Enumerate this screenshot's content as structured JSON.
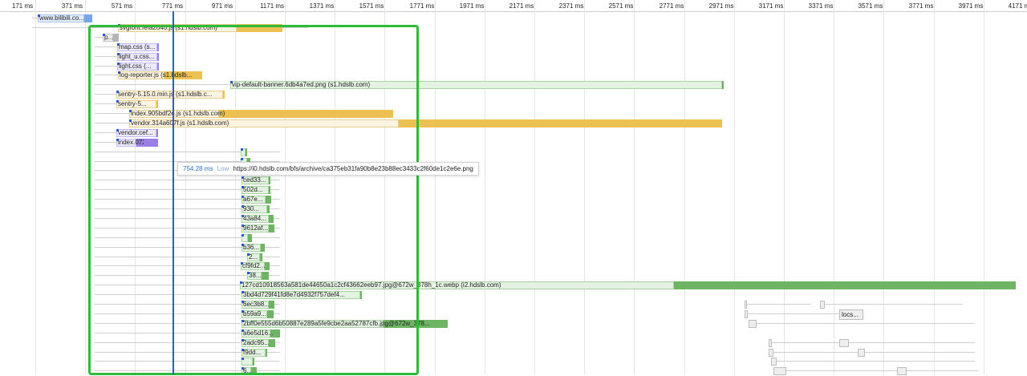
{
  "ruler": {
    "ticks": [
      "171 ms",
      "371 ms",
      "571 ms",
      "771 ms",
      "971 ms",
      "1171 ms",
      "1371 ms",
      "1571 ms",
      "1771 ms",
      "1971 ms",
      "2171 ms",
      "2371 ms",
      "2571 ms",
      "2771 ms",
      "2971 ms",
      "3171 ms",
      "3371 ms",
      "3571 ms",
      "3771 ms",
      "3971 ms",
      "4171 ms"
    ]
  },
  "requests": [
    {
      "label": "www.bilibili.co...",
      "kind": "doc"
    },
    {
      "label": "svgfont.fefa2646.js (s1.hdslb.com)",
      "kind": "script"
    },
    {
      "label": "p...",
      "kind": "other"
    },
    {
      "label": "map.css (s...",
      "kind": "css"
    },
    {
      "label": "light_u.css...",
      "kind": "css"
    },
    {
      "label": "light.css (...",
      "kind": "css"
    },
    {
      "label": "log-reporter.js (s1.hdslb...",
      "kind": "script"
    },
    {
      "label": "vip-default-banner.6db4a7ed.png (s1.hdslb.com)",
      "kind": "image"
    },
    {
      "label": "sentry-5.15.0.min.js (s1.hdslb.c...",
      "kind": "script"
    },
    {
      "label": "sentry-5...",
      "kind": "script"
    },
    {
      "label": "index.905bdf2e.js (s1.hdslb.com)",
      "kind": "script"
    },
    {
      "label": "vendor.314a607f.js (s1.hdslb.com)",
      "kind": "script"
    },
    {
      "label": "vendor.cef...",
      "kind": "css"
    },
    {
      "label": "index.072...",
      "kind": "css"
    },
    {
      "label": "",
      "kind": "image"
    },
    {
      "label": "",
      "kind": "image"
    },
    {
      "label": "",
      "kind": "image"
    },
    {
      "label": "ced33...",
      "kind": "image"
    },
    {
      "label": "502d...",
      "kind": "image"
    },
    {
      "label": "a67e...",
      "kind": "image"
    },
    {
      "label": "930...",
      "kind": "image"
    },
    {
      "label": "43a84...",
      "kind": "image"
    },
    {
      "label": "9612af...",
      "kind": "image"
    },
    {
      "label": "",
      "kind": "image"
    },
    {
      "label": "b36...",
      "kind": "image"
    },
    {
      "label": "2...",
      "kind": "image"
    },
    {
      "label": "cf9fd2...",
      "kind": "image"
    },
    {
      "label": "38...",
      "kind": "image"
    },
    {
      "label": "127cd10918563a581de44650a1c2cf43662eeb97.jpg@672w_378h_1c.webp (i2.hdslb.com)",
      "kind": "image"
    },
    {
      "label": "3bd4d729f41fd8e7d4932f757def4...",
      "kind": "image"
    },
    {
      "label": "6ec3b8...",
      "kind": "image"
    },
    {
      "label": "b59a9...",
      "kind": "image"
    },
    {
      "label": "2bff0e555d6b50887e289a5fe9cbe2aa52787cfb.jpg@672w_378...",
      "kind": "image"
    },
    {
      "label": "a6e5d16...",
      "kind": "image"
    },
    {
      "label": "2adc95...",
      "kind": "image"
    },
    {
      "label": "f9dd...",
      "kind": "image"
    },
    {
      "label": "",
      "kind": "image"
    },
    {
      "label": "6...",
      "kind": "image"
    }
  ],
  "side_requests": [
    {
      "label": "locs..."
    }
  ],
  "tooltip": {
    "time": "754.28 ms",
    "priority": "Low",
    "url": "https://i0.hdslb.com/bfs/archive/ca375eb31fa90b8e23b88ec3433c2f60de1c2e6e.png"
  },
  "colors": {
    "accent": "#3b7ddd",
    "highlight_box": "#2fbb3a",
    "cursor_line": "#2563b4",
    "script_wait": "#fdf3e1",
    "script_download": "#edc052",
    "image_wait": "#e4f3e1",
    "image_download": "#6fb365",
    "css_wait": "#ece9fb",
    "css_download": "#9a80e4",
    "doc_wait": "#e3eefb",
    "doc_download": "#76a6e6"
  }
}
